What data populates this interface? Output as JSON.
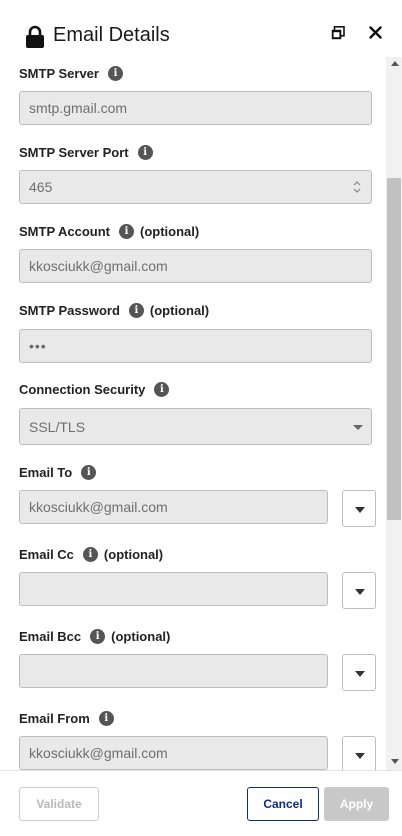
{
  "header": {
    "title": "Email Details",
    "lock_icon": "lock-icon",
    "restore_icon": "window-restore-icon",
    "close_icon": "close-icon"
  },
  "fields": {
    "smtp_server": {
      "label": "SMTP Server",
      "value": "smtp.gmail.com"
    },
    "smtp_port": {
      "label": "SMTP Server Port",
      "value": "465"
    },
    "smtp_account": {
      "label": "SMTP Account",
      "optional": "(optional)",
      "value": "kkosciukk@gmail.com"
    },
    "smtp_password": {
      "label": "SMTP Password",
      "optional": "(optional)",
      "value": "•••"
    },
    "connection_security": {
      "label": "Connection Security",
      "value": "SSL/TLS"
    },
    "email_to": {
      "label": "Email To",
      "value": "kkosciukk@gmail.com"
    },
    "email_cc": {
      "label": "Email Cc",
      "optional": "(optional)",
      "value": ""
    },
    "email_bcc": {
      "label": "Email Bcc",
      "optional": "(optional)",
      "value": ""
    },
    "email_from": {
      "label": "Email From",
      "value": "kkosciukk@gmail.com"
    }
  },
  "info_glyph": "i",
  "footer": {
    "validate_label": "Validate",
    "cancel_label": "Cancel",
    "apply_label": "Apply"
  },
  "colors": {
    "cancel_border": "#0a2d82",
    "disabled": "#c8c8c8",
    "input_bg": "#e9e9e9"
  }
}
